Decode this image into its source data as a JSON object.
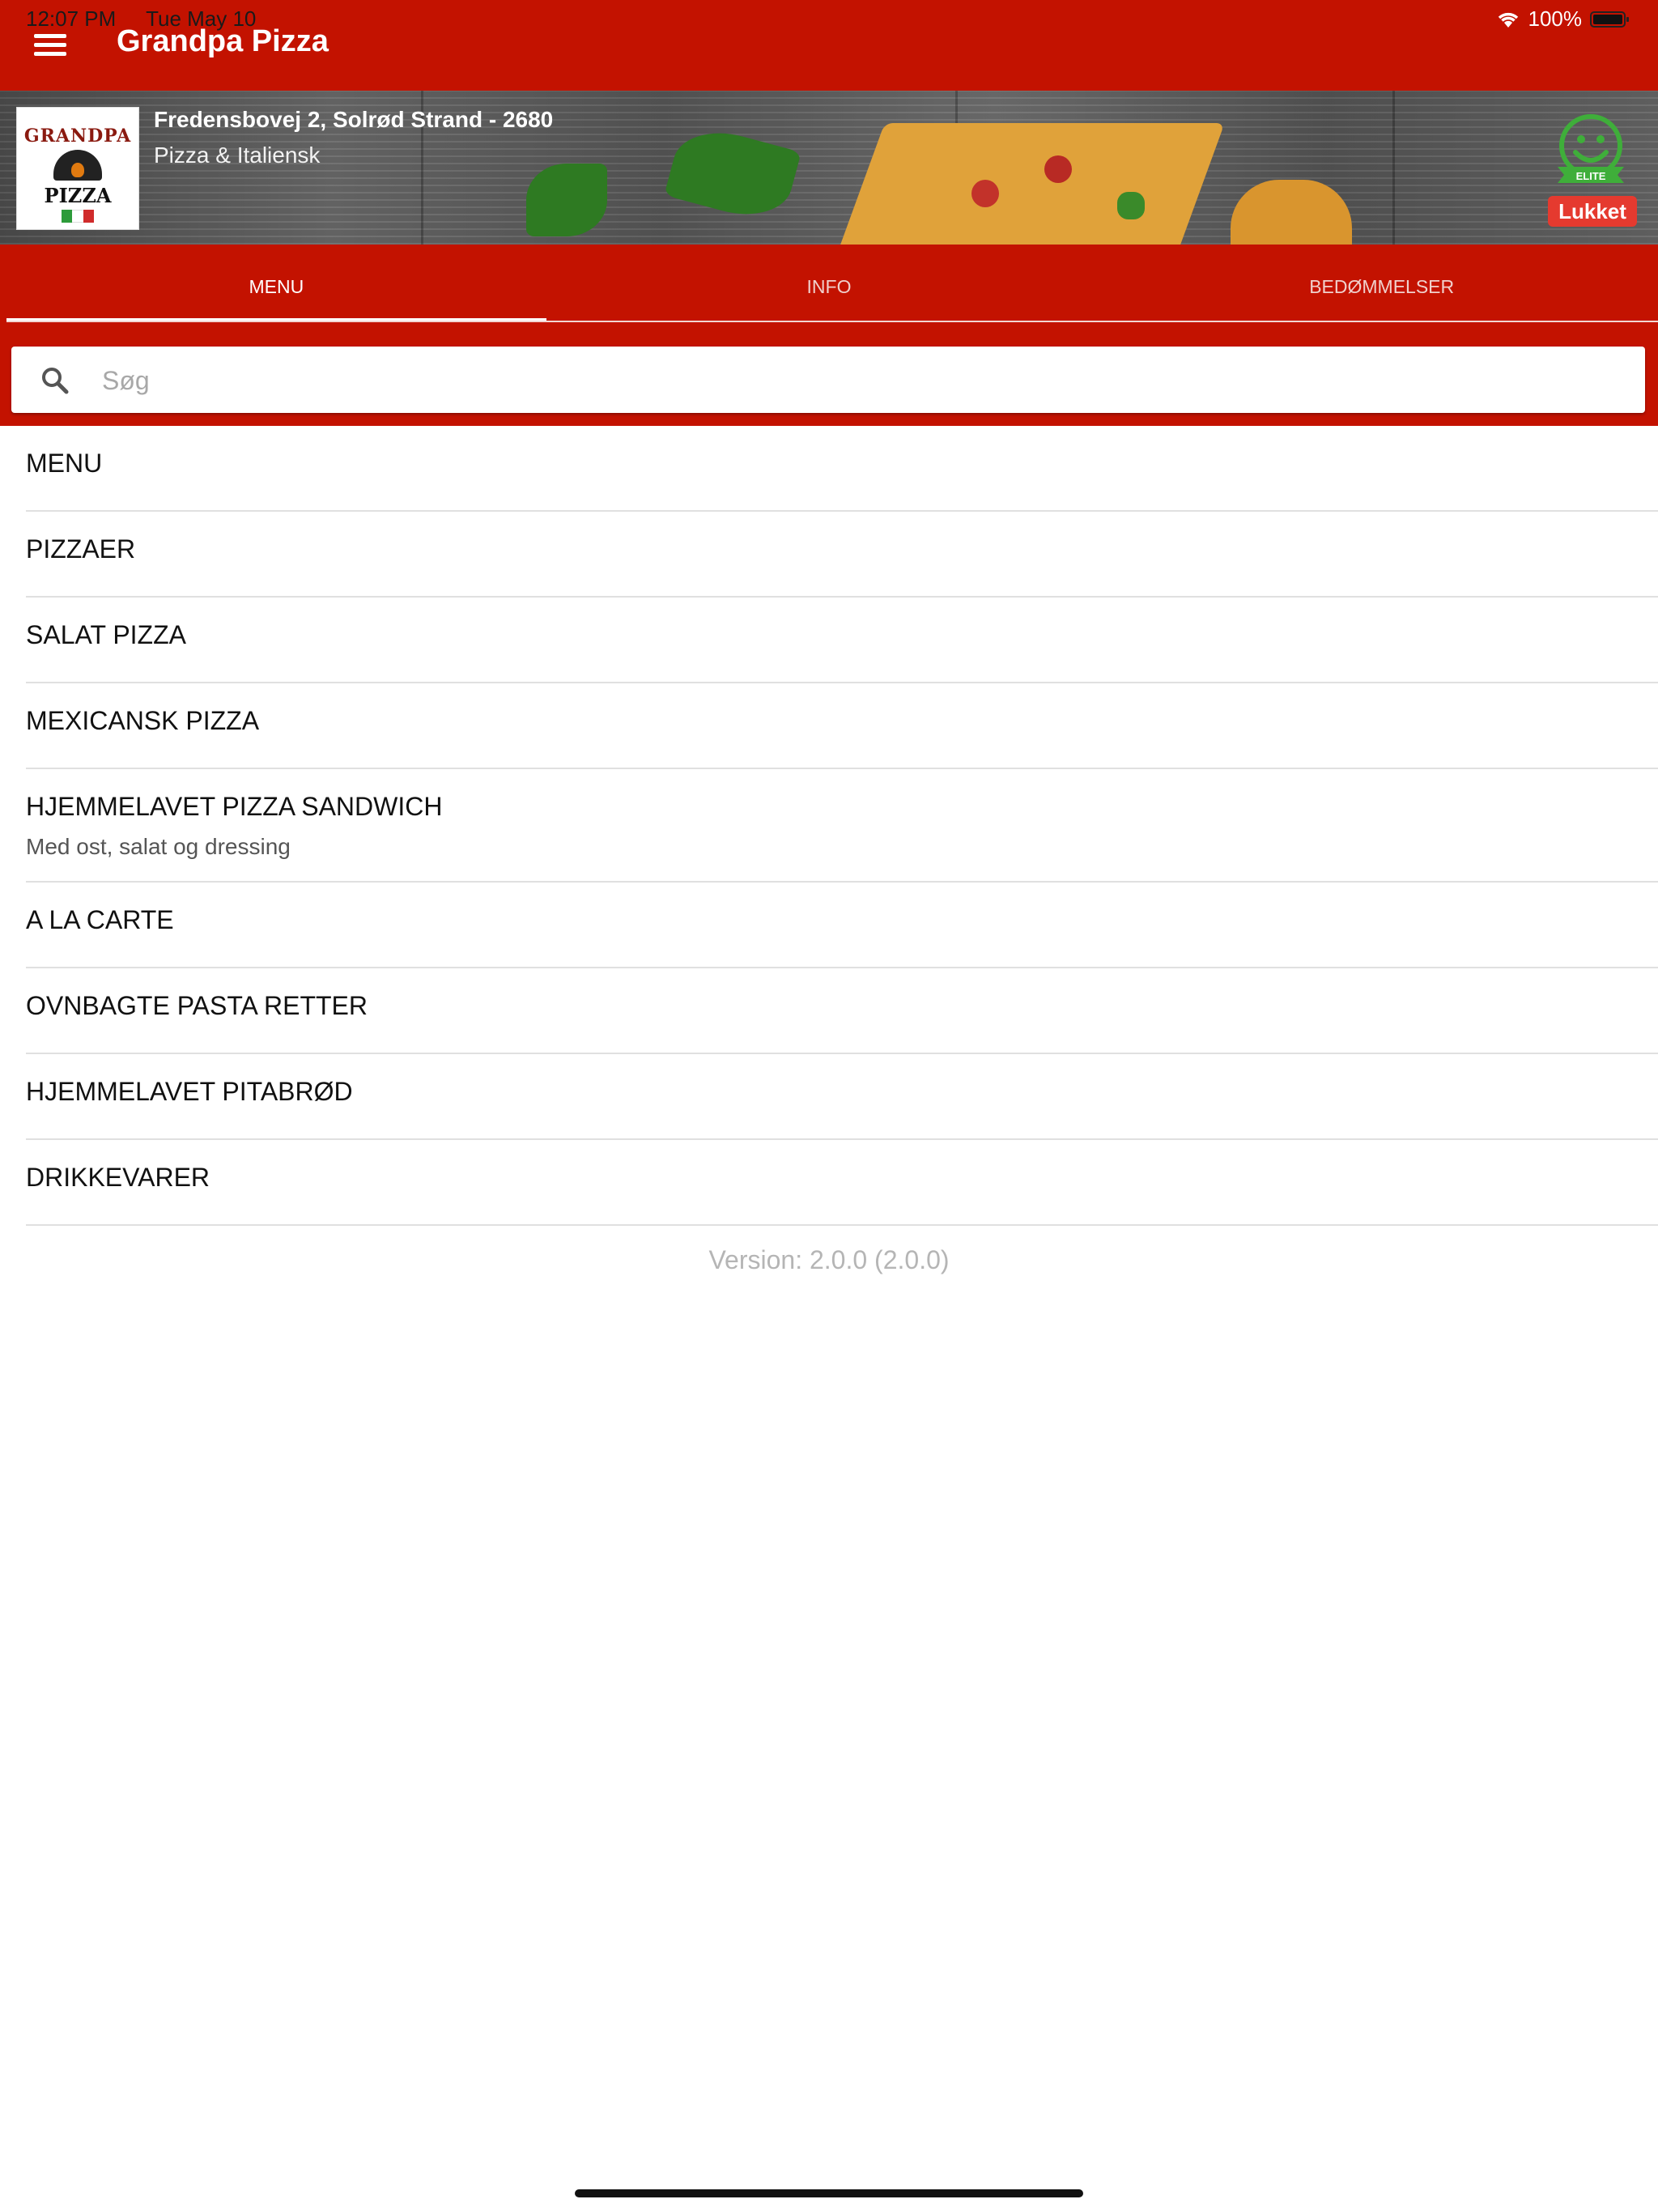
{
  "status_bar": {
    "time": "12:07 PM",
    "date": "Tue May 10",
    "battery": "100%"
  },
  "app": {
    "title": "Grandpa Pizza"
  },
  "restaurant": {
    "address": "Fredensbovej 2, Solrød Strand - 2680",
    "cuisine": "Pizza & Italiensk",
    "logo_text_top": "GRANDPA",
    "logo_text_bottom": "PIZZA",
    "smiley_label": "ELITE",
    "status": "Lukket"
  },
  "tabs": [
    {
      "label": "MENU",
      "active": true
    },
    {
      "label": "INFO",
      "active": false
    },
    {
      "label": "BEDØMMELSER",
      "active": false
    }
  ],
  "search": {
    "placeholder": "Søg",
    "value": ""
  },
  "menu_items": [
    {
      "title": "MENU"
    },
    {
      "title": "PIZZAER"
    },
    {
      "title": "SALAT PIZZA"
    },
    {
      "title": "MEXICANSK PIZZA"
    },
    {
      "title": "HJEMMELAVET PIZZA SANDWICH",
      "subtitle": "Med ost, salat og dressing"
    },
    {
      "title": "A LA CARTE"
    },
    {
      "title": "OVNBAGTE PASTA RETTER"
    },
    {
      "title": "HJEMMELAVET PITABRØD"
    },
    {
      "title": "DRIKKEVARER"
    }
  ],
  "version_text": "Version: 2.0.0 (2.0.0)",
  "colors": {
    "brand": "#c31200",
    "status_closed": "#e53a2f",
    "smiley_green": "#3fae3a"
  }
}
